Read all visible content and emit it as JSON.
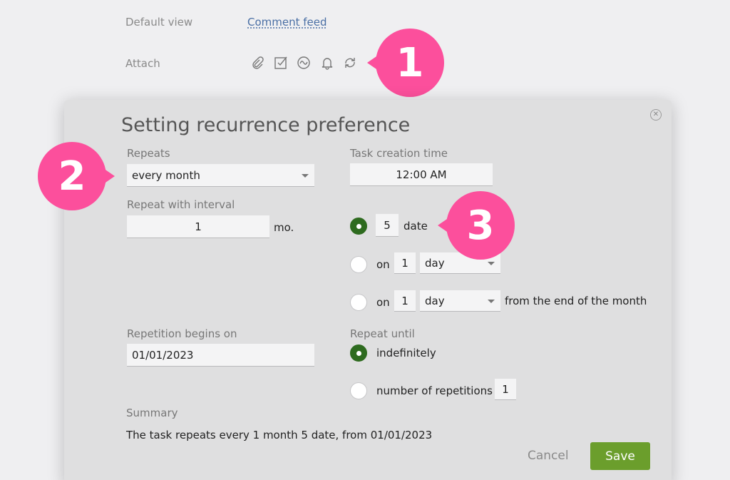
{
  "background": {
    "default_view_label": "Default view",
    "default_view_value": "Comment feed",
    "attach_label": "Attach",
    "attach_icons": [
      "paperclip-icon",
      "checkbox-icon",
      "wave-icon",
      "bell-icon",
      "repeat-icon"
    ]
  },
  "dialog": {
    "title": "Setting recurrence preference",
    "repeats_label": "Repeats",
    "repeats_value": "every month",
    "task_creation_time_label": "Task creation time",
    "task_creation_time_value": "12:00 AM",
    "repeat_interval_label": "Repeat with interval",
    "repeat_interval_value": "1",
    "repeat_interval_unit": "mo.",
    "monthly_options": {
      "date_option": {
        "selected": true,
        "value": "5",
        "suffix": "date"
      },
      "on_day_option": {
        "selected": false,
        "prefix": "on",
        "number": "1",
        "unit": "day"
      },
      "from_end_option": {
        "selected": false,
        "prefix": "on",
        "number": "1",
        "unit": "day",
        "suffix": "from the end of the month"
      }
    },
    "repetition_begins_label": "Repetition begins on",
    "repetition_begins_value": "01/01/2023",
    "repeat_until_label": "Repeat until",
    "indefinitely_label": "indefinitely",
    "indefinitely_selected": true,
    "number_of_repetitions_label": "number of repetitions",
    "number_of_repetitions_value": "1",
    "summary_label": "Summary",
    "summary_text": "The task repeats every 1 month 5 date, from 01/01/2023",
    "cancel_label": "Cancel",
    "save_label": "Save"
  },
  "callouts": [
    "1",
    "2",
    "3"
  ],
  "colors": {
    "callout": "#fc4f9c",
    "save_button": "#6b9e2c",
    "radio_selected": "#2e6b1f",
    "link": "#4a6fa5"
  }
}
